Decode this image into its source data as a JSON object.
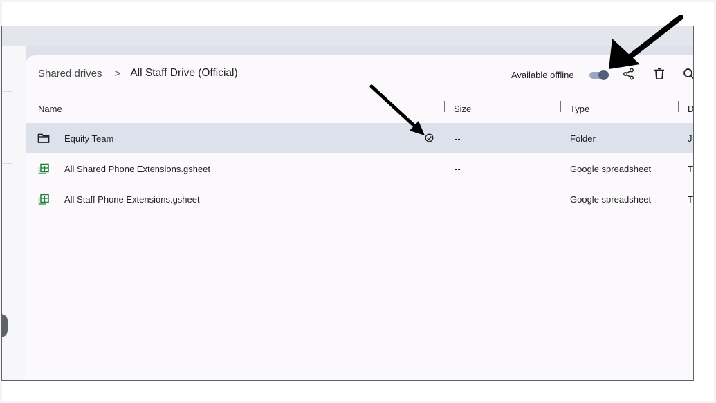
{
  "breadcrumb": {
    "parent": "Shared drives",
    "separator": ">",
    "current": "All Staff Drive (Official)"
  },
  "toolbar": {
    "offline_label": "Available offline",
    "offline_enabled": true,
    "icons": [
      "share-icon",
      "trash-icon",
      "search-icon"
    ]
  },
  "columns": {
    "name": "Name",
    "size": "Size",
    "type": "Type",
    "date_partial": "D"
  },
  "rows": [
    {
      "icon": "folder-icon",
      "name": "Equity Team",
      "size": "--",
      "type": "Folder",
      "date_partial": "J",
      "selected": true,
      "status_icon": "offline-available-icon"
    },
    {
      "icon": "gsheet-icon",
      "name": "All Shared Phone Extensions.gsheet",
      "size": "--",
      "type": "Google spreadsheet",
      "date_partial": "T",
      "selected": false
    },
    {
      "icon": "gsheet-icon",
      "name": "All Staff Phone Extensions.gsheet",
      "size": "--",
      "type": "Google spreadsheet",
      "date_partial": "T",
      "selected": false
    }
  ],
  "colors": {
    "selected_row": "#dce1ec",
    "sheet_green": "#188038",
    "toggle_track": "#9aa6c2",
    "toggle_knob": "#52607a",
    "annotation_arrow": "#000000"
  },
  "annotations": [
    "arrow-to-toggle",
    "arrow-to-status-icon"
  ]
}
